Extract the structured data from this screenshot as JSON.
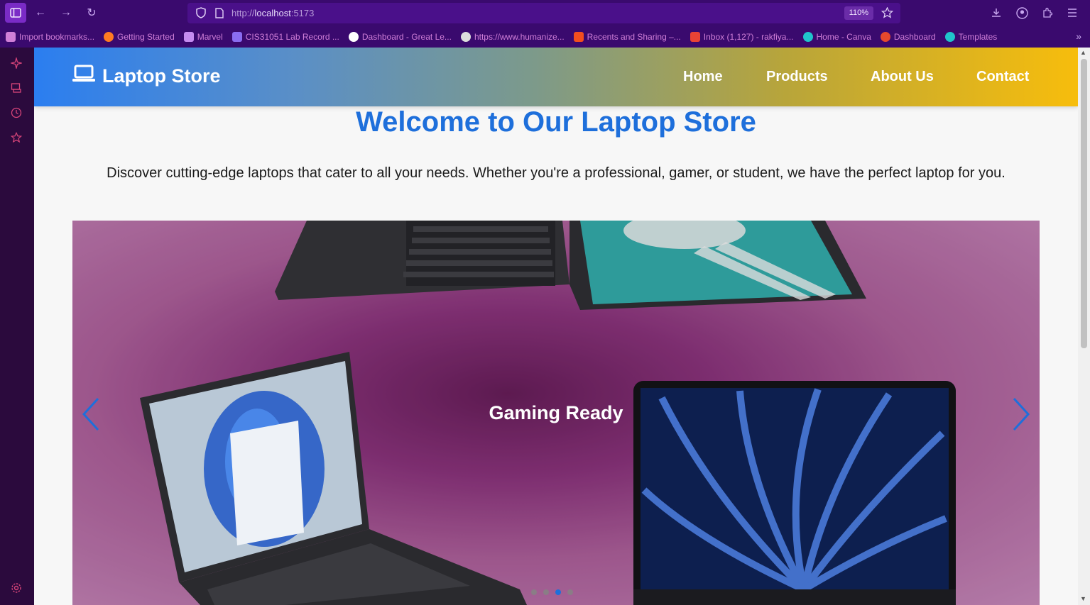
{
  "browser": {
    "url_prefix": "http://",
    "url_host": "localhost",
    "url_port": ":5173",
    "zoom": "110%"
  },
  "bookmarks": [
    {
      "label": "Import bookmarks...",
      "icon": "import-icon",
      "color": "#d07fd8"
    },
    {
      "label": "Getting Started",
      "icon": "firefox-icon",
      "color": "#ff7b22"
    },
    {
      "label": "Marvel",
      "icon": "marvel-icon",
      "color": "#c58cf0"
    },
    {
      "label": "CIS31051 Lab Record ...",
      "icon": "document-icon",
      "color": "#8a6cf0"
    },
    {
      "label": "Dashboard - Great Le...",
      "icon": "google-icon",
      "color": "#ffffff"
    },
    {
      "label": "https://www.humanize...",
      "icon": "globe-icon",
      "color": "#dddddd"
    },
    {
      "label": "Recents and Sharing –...",
      "icon": "figma-icon",
      "color": "#f24e1e"
    },
    {
      "label": "Inbox (1,127) - rakfiya...",
      "icon": "gmail-icon",
      "color": "#ea4335"
    },
    {
      "label": "Home - Canva",
      "icon": "canva-icon",
      "color": "#20c4cb"
    },
    {
      "label": "Dashboard",
      "icon": "dashboard-icon",
      "color": "#e6492d"
    },
    {
      "label": "Templates",
      "icon": "canva-icon",
      "color": "#20c4cb"
    }
  ],
  "site": {
    "brand": "Laptop Store",
    "nav": [
      "Home",
      "Products",
      "About Us",
      "Contact"
    ],
    "hero_title": "Welcome to Our Laptop Store",
    "hero_subtitle": "Discover cutting-edge laptops that cater to all your needs. Whether you're a professional, gamer, or student, we have the perfect laptop for you.",
    "carousel": {
      "caption": "Gaming Ready",
      "slides_count": 4,
      "active_index": 2
    }
  },
  "colors": {
    "accent_blue": "#1e6fdb",
    "nav_gradient_start": "#2b7ef0",
    "nav_gradient_end": "#f7bd0c"
  }
}
